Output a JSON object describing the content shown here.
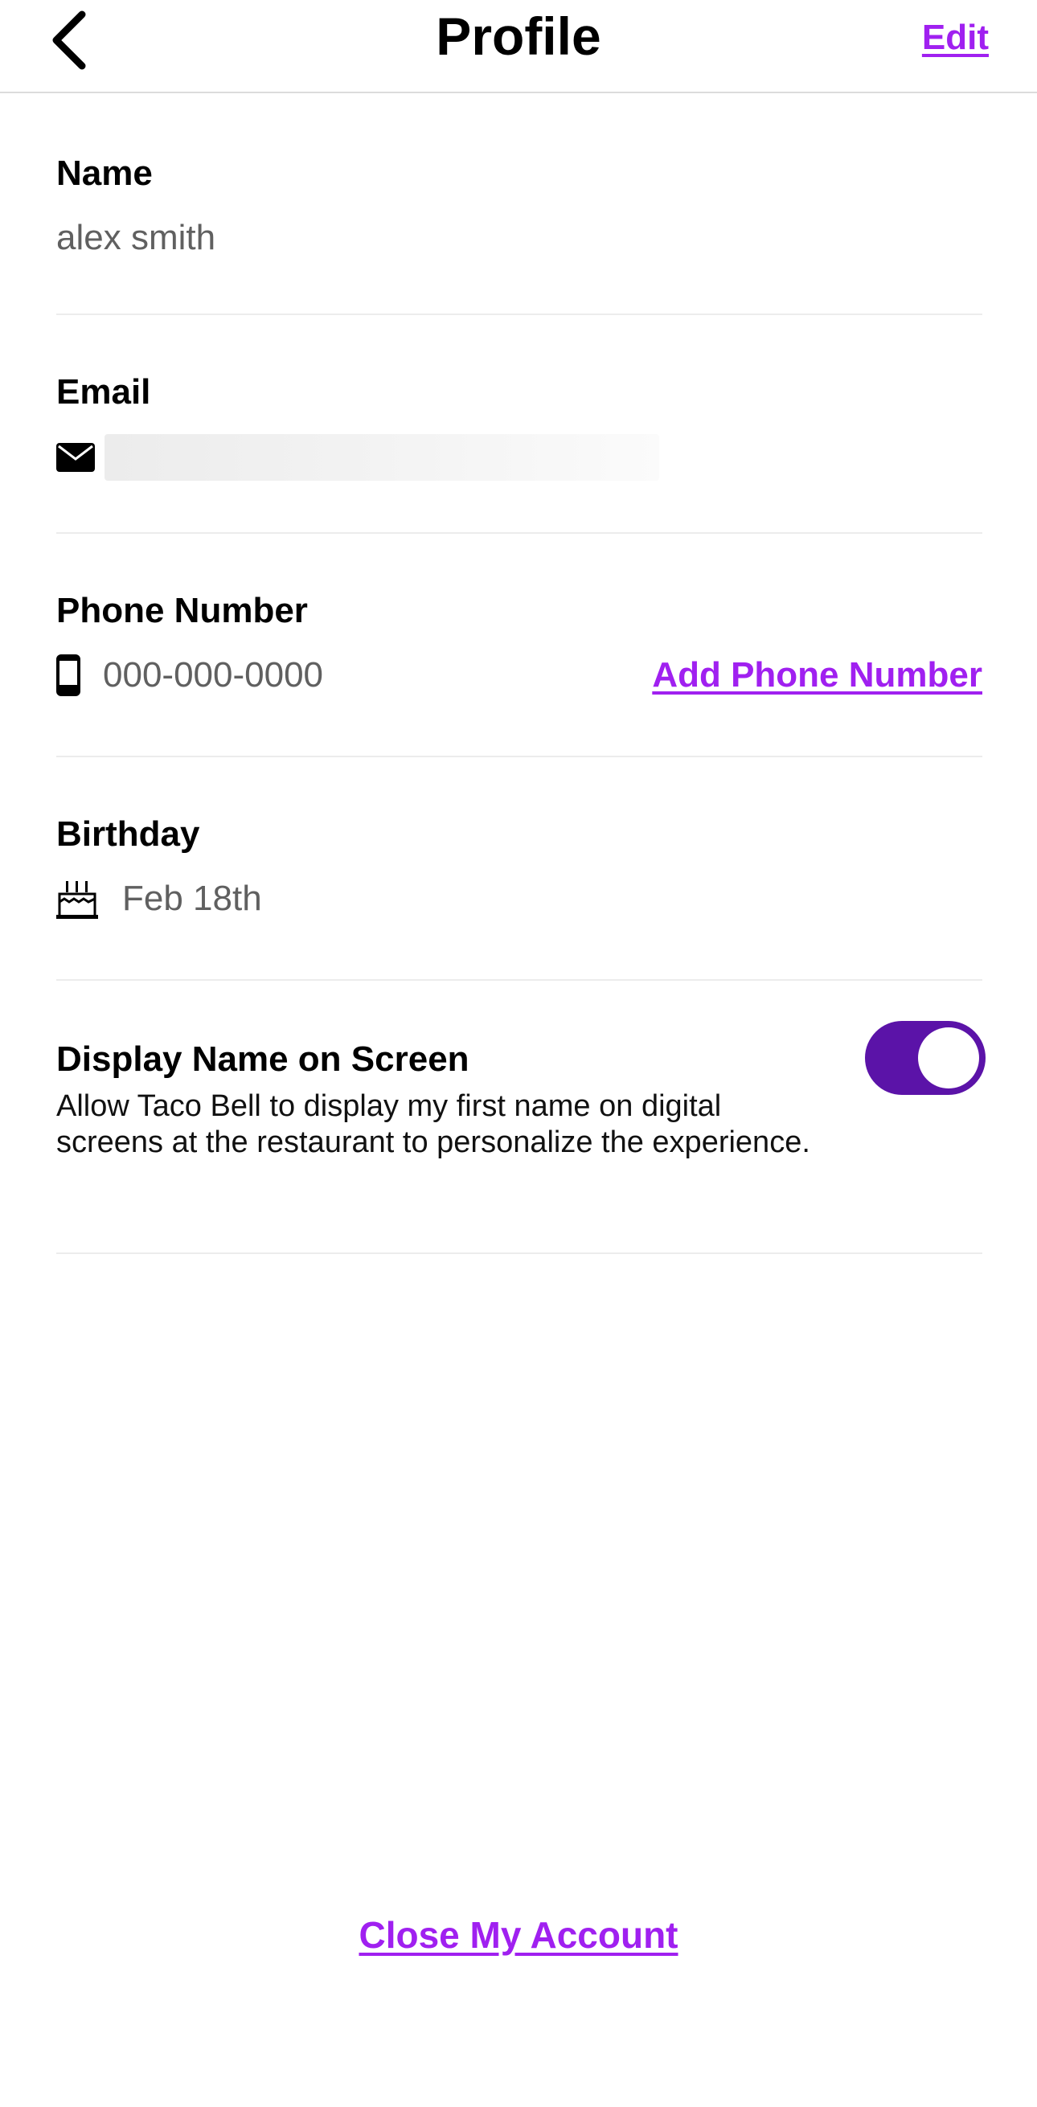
{
  "header": {
    "title": "Profile",
    "edit_label": "Edit"
  },
  "name": {
    "label": "Name",
    "value": "alex smith"
  },
  "email": {
    "label": "Email",
    "icon": "envelope-icon"
  },
  "phone": {
    "label": "Phone Number",
    "value": "000-000-0000",
    "icon": "mobile-phone-icon",
    "add_label": "Add Phone Number"
  },
  "birthday": {
    "label": "Birthday",
    "value": "Feb 18th",
    "icon": "birthday-cake-icon"
  },
  "display_name": {
    "label": "Display Name on Screen",
    "description": "Allow Taco Bell to display my first name on digital screens at the restaurant to personalize the experience.",
    "toggle_on": true
  },
  "footer": {
    "close_account_label": "Close My Account"
  },
  "colors": {
    "accent": "#a020f0",
    "toggle_on": "#5b13a8"
  }
}
